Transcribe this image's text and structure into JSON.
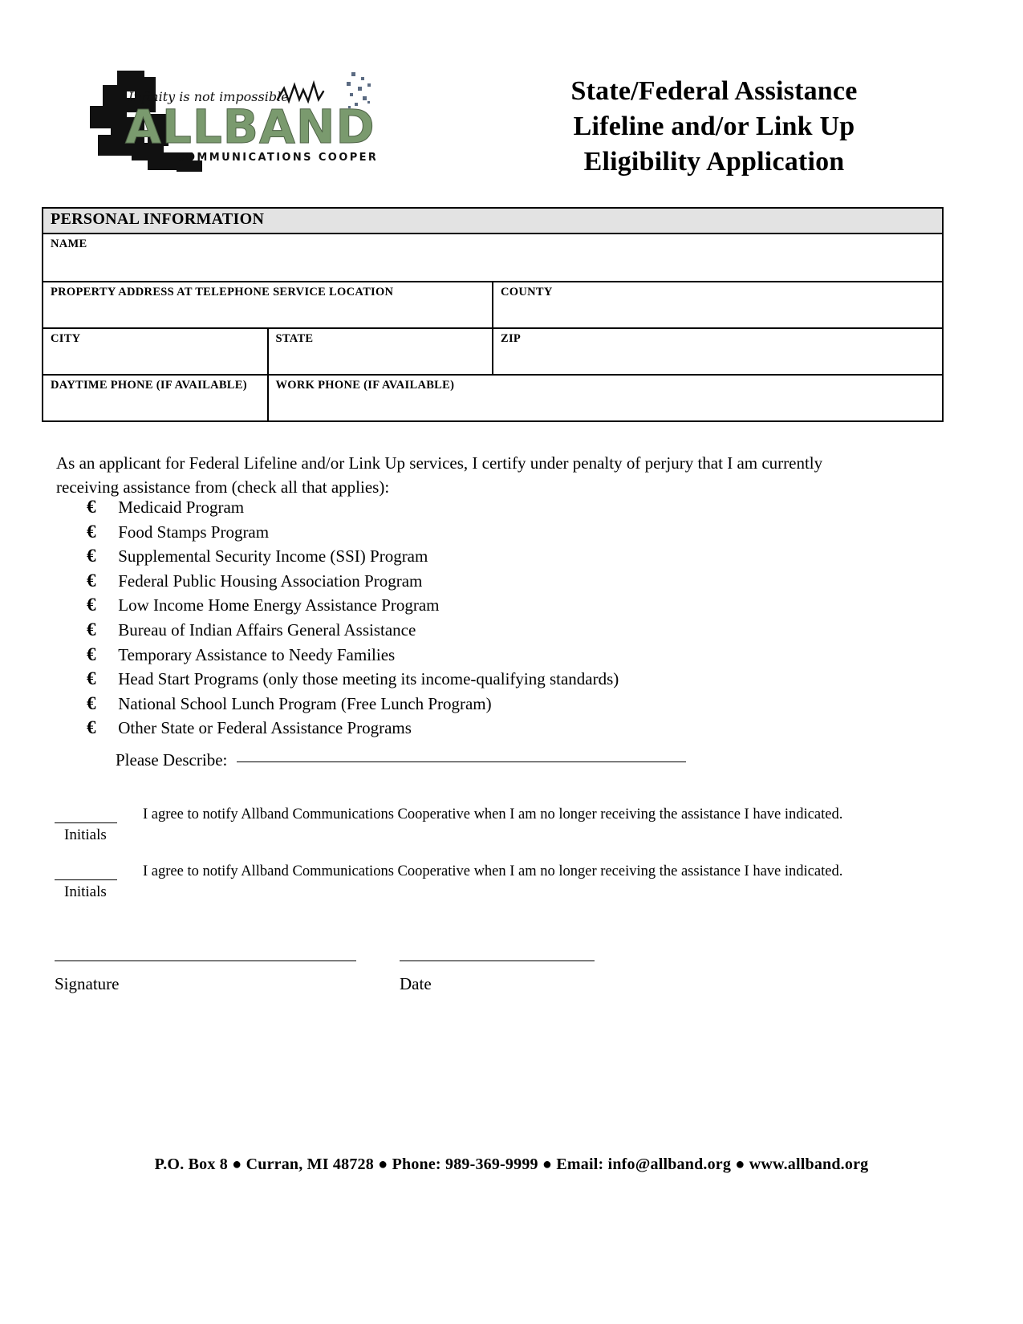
{
  "header": {
    "logo": {
      "tagline": "Infinity is not impossible",
      "wordmark": "ALLBAND",
      "subtitle": "COMMUNICATIONS COOPERATIVE",
      "wordmark_color": "#7a9a6e",
      "block_color": "#000000"
    },
    "title_lines": [
      "State/Federal Assistance",
      "Lifeline and/or Link Up",
      "Eligibility Application"
    ]
  },
  "personal_information": {
    "section_title": "PERSONAL INFORMATION",
    "section_bg": "#e3e3e3",
    "fields": {
      "name": "NAME",
      "property_address": "PROPERTY ADDRESS AT TELEPHONE SERVICE LOCATION",
      "county": "COUNTY",
      "city": "CITY",
      "state": "STATE",
      "zip": "ZIP",
      "daytime_phone": "DAYTIME PHONE (IF AVAILABLE)",
      "work_phone": "WORK PHONE (IF AVAILABLE)"
    }
  },
  "certification": {
    "intro": "As an applicant for Federal Lifeline and/or Link Up services, I certify under penalty of perjury that I am currently receiving assistance from (check all that applies):",
    "checkbox_glyph": "€",
    "programs": [
      "Medicaid Program",
      "Food Stamps Program",
      "Supplemental Security Income (SSI) Program",
      "Federal Public Housing Association Program",
      "Low Income Home Energy Assistance Program",
      "Bureau of Indian Affairs General Assistance",
      "Temporary Assistance to Needy Families",
      "Head Start Programs (only those meeting its income-qualifying standards)",
      "National School Lunch Program (Free Lunch Program)",
      "Other State or Federal Assistance Programs"
    ],
    "describe_label": "Please Describe:"
  },
  "agreements": [
    {
      "caption": "Initials",
      "text": "I agree to notify Allband Communications Cooperative when I am no longer receiving the assistance I have indicated."
    },
    {
      "caption": "Initials",
      "text": "I agree to notify Allband Communications Cooperative when I am no longer receiving the assistance I have indicated."
    }
  ],
  "signature_block": {
    "signature_label": "Signature",
    "date_label": "Date"
  },
  "footer": {
    "text": "P.O. Box 8 ● Curran, MI 48728 ● Phone: 989-369-9999 ● Email: info@allband.org ● www.allband.org"
  }
}
